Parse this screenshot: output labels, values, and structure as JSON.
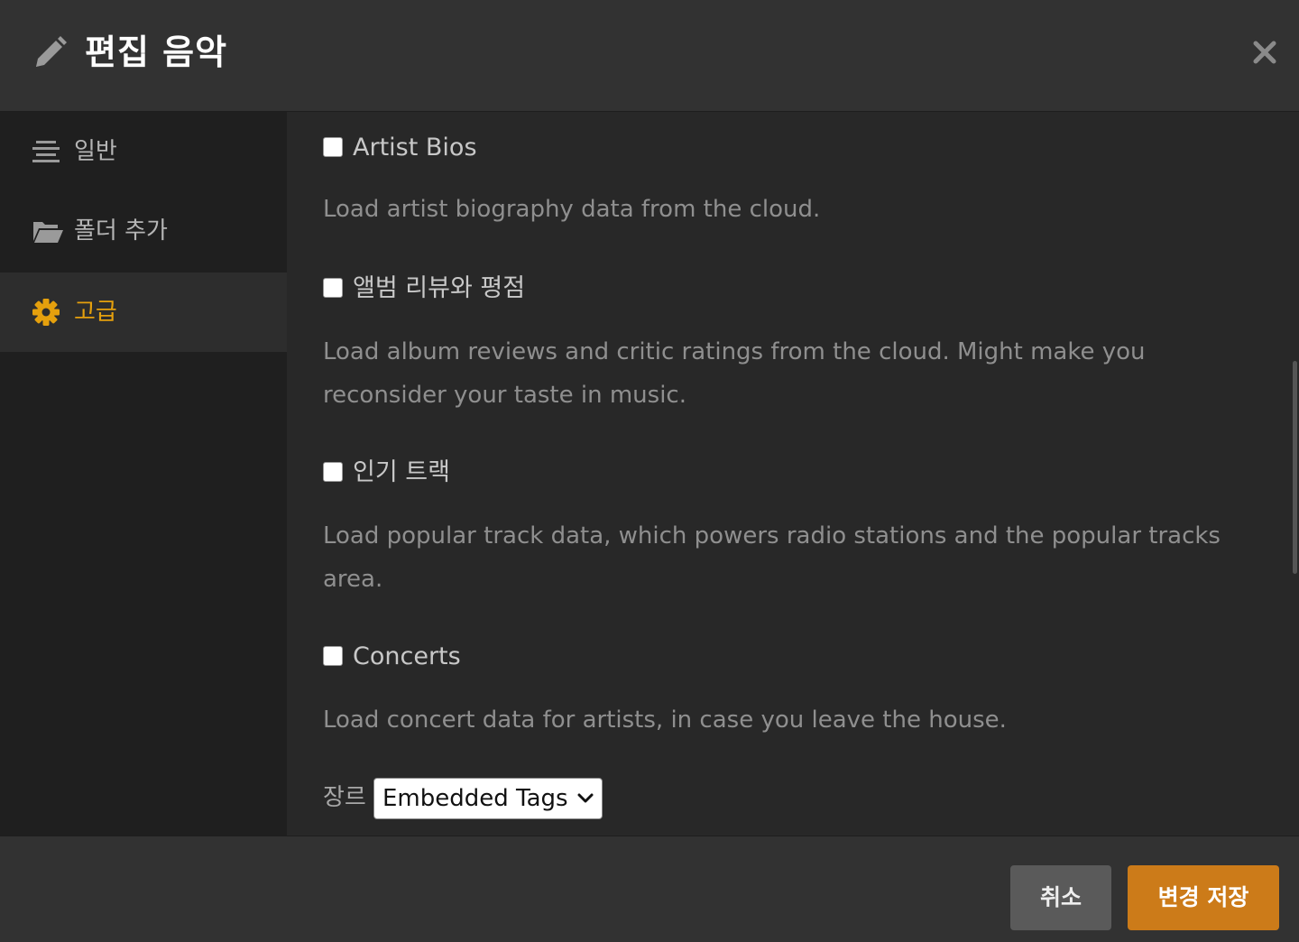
{
  "header": {
    "title": "편집 음악",
    "icon": "pencil-icon",
    "close_icon": "close-icon"
  },
  "sidebar": {
    "items": [
      {
        "label": "일반",
        "icon": "align-center-icon",
        "active": false
      },
      {
        "label": "폴더 추가",
        "icon": "folder-open-icon",
        "active": false
      },
      {
        "label": "고급",
        "icon": "gear-icon",
        "active": true
      }
    ]
  },
  "options": [
    {
      "label": "Artist Bios",
      "checked": false,
      "description": "Load artist biography data from the cloud."
    },
    {
      "label": "앨범 리뷰와 평점",
      "checked": false,
      "description": "Load album reviews and critic ratings from the cloud. Might make you reconsider your taste in music."
    },
    {
      "label": "인기 트랙",
      "checked": false,
      "description": "Load popular track data, which powers radio stations and the popular tracks area."
    },
    {
      "label": "Concerts",
      "checked": false,
      "description": "Load concert data for artists, in case you leave the house."
    }
  ],
  "genre": {
    "label": "장르",
    "selected": "Embedded Tags"
  },
  "footer": {
    "cancel_label": "취소",
    "save_label": "변경 저장"
  },
  "colors": {
    "accent": "#e5a00d",
    "save_button": "#cc7b19",
    "cancel_button": "#5a5a5a",
    "sidebar_bg": "#1f1f1f",
    "content_bg": "#282828",
    "header_bg": "#323232"
  }
}
